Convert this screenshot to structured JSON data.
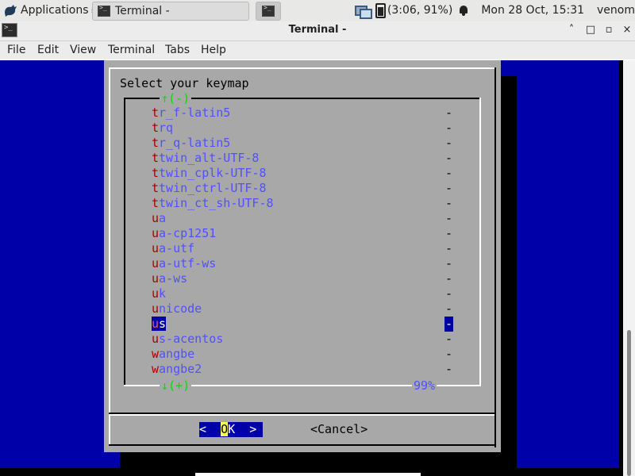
{
  "panel": {
    "applications_label": "Applications",
    "task1_label": "Terminal -",
    "battery_text": "(3:06, 91%)",
    "datetime": "Mon 28 Oct, 15:31",
    "user": "venom"
  },
  "window": {
    "title": "Terminal -",
    "minimize": "˄",
    "maximize": "□",
    "close": "×"
  },
  "menu": [
    "File",
    "Edit",
    "View",
    "Terminal",
    "Tabs",
    "Help"
  ],
  "dialog": {
    "title": "Select your keymap",
    "scroll_up": "↑(-)",
    "scroll_down": "↓(+)",
    "percent": "99%",
    "items": [
      {
        "hot": "t",
        "rest": "r_f-latin5",
        "tag": "-"
      },
      {
        "hot": "t",
        "rest": "rq",
        "tag": "-"
      },
      {
        "hot": "t",
        "rest": "r_q-latin5",
        "tag": "-"
      },
      {
        "hot": "t",
        "rest": "twin_alt-UTF-8",
        "tag": "-"
      },
      {
        "hot": "t",
        "rest": "twin_cplk-UTF-8",
        "tag": "-"
      },
      {
        "hot": "t",
        "rest": "twin_ctrl-UTF-8",
        "tag": "-"
      },
      {
        "hot": "t",
        "rest": "twin_ct_sh-UTF-8",
        "tag": "-"
      },
      {
        "hot": "u",
        "rest": "a",
        "tag": "-"
      },
      {
        "hot": "u",
        "rest": "a-cp1251",
        "tag": "-"
      },
      {
        "hot": "u",
        "rest": "a-utf",
        "tag": "-"
      },
      {
        "hot": "u",
        "rest": "a-utf-ws",
        "tag": "-"
      },
      {
        "hot": "u",
        "rest": "a-ws",
        "tag": "-"
      },
      {
        "hot": "u",
        "rest": "k",
        "tag": "-"
      },
      {
        "hot": "u",
        "rest": "nicode",
        "tag": "-"
      },
      {
        "hot": "u",
        "rest": "s",
        "tag": "-",
        "selected": true
      },
      {
        "hot": "u",
        "rest": "s-acentos",
        "tag": "-"
      },
      {
        "hot": "w",
        "rest": "angbe",
        "tag": "-"
      },
      {
        "hot": "w",
        "rest": "angbe2",
        "tag": "-"
      }
    ],
    "ok_left": "<  ",
    "ok_hot": "O",
    "ok_right": "K  >",
    "cancel_label": "<Cancel>"
  }
}
